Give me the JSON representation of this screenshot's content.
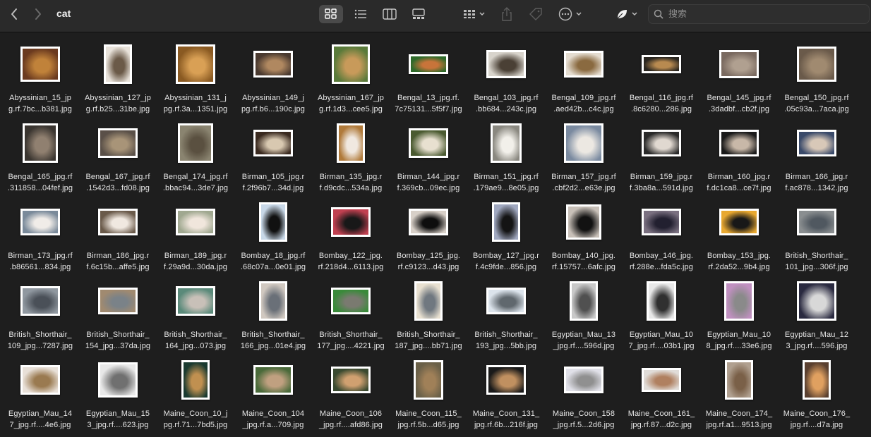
{
  "window": {
    "title": "cat"
  },
  "toolbar": {
    "views": [
      "icon-view",
      "list-view",
      "column-view",
      "gallery-view"
    ],
    "active_view": "icon-view"
  },
  "search": {
    "placeholder": "搜索",
    "value": ""
  },
  "files": [
    {
      "l1": "Abyssinian_15_jp",
      "l2": "g.rf.7bc...b381.jpg"
    },
    {
      "l1": "Abyssinian_127_jp",
      "l2": "g.rf.b25...31be.jpg"
    },
    {
      "l1": "Abyssinian_131_j",
      "l2": "pg.rf.3a...1351.jpg"
    },
    {
      "l1": "Abyssinian_149_j",
      "l2": "pg.rf.b6...190c.jpg"
    },
    {
      "l1": "Abyssinian_167_jp",
      "l2": "g.rf.1d3...cee5.jpg"
    },
    {
      "l1": "Bengal_13_jpg.rf.",
      "l2": "7c75131...5f5f7.jpg"
    },
    {
      "l1": "Bengal_103_jpg.rf",
      "l2": ".bb684...243c.jpg"
    },
    {
      "l1": "Bengal_109_jpg.rf",
      "l2": ".aed42b...c4c.jpg"
    },
    {
      "l1": "Bengal_116_jpg.rf",
      "l2": ".8c6280...286.jpg"
    },
    {
      "l1": "Bengal_145_jpg.rf",
      "l2": ".3dadbf...cb2f.jpg"
    },
    {
      "l1": "Bengal_150_jpg.rf",
      "l2": ".05c93a...7aca.jpg"
    },
    {
      "l1": "Bengal_165_jpg.rf",
      "l2": ".311858...04fef.jpg"
    },
    {
      "l1": "Bengal_167_jpg.rf",
      "l2": ".1542d3...fd08.jpg"
    },
    {
      "l1": "Bengal_174_jpg.rf",
      "l2": ".bbac94...3de7.jpg"
    },
    {
      "l1": "Birman_105_jpg.r",
      "l2": "f.2f96b7...34d.jpg"
    },
    {
      "l1": "Birman_135_jpg.r",
      "l2": "f.d9cdc...534a.jpg"
    },
    {
      "l1": "Birman_144_jpg.r",
      "l2": "f.369cb...09ec.jpg"
    },
    {
      "l1": "Birman_151_jpg.rf",
      "l2": ".179ae9...8e05.jpg"
    },
    {
      "l1": "Birman_157_jpg.rf",
      "l2": ".cbf2d2...e63e.jpg"
    },
    {
      "l1": "Birman_159_jpg.r",
      "l2": "f.3ba8a...591d.jpg"
    },
    {
      "l1": "Birman_160_jpg.r",
      "l2": "f.dc1ca8...ce7f.jpg"
    },
    {
      "l1": "Birman_166_jpg.r",
      "l2": "f.ac878...1342.jpg"
    },
    {
      "l1": "Birman_173_jpg.rf",
      "l2": ".b86561...834.jpg"
    },
    {
      "l1": "Birman_186_jpg.r",
      "l2": "f.6c15b...affe5.jpg"
    },
    {
      "l1": "Birman_189_jpg.r",
      "l2": "f.29a9d...30da.jpg"
    },
    {
      "l1": "Bombay_18_jpg.rf",
      "l2": ".68c07a...0e01.jpg"
    },
    {
      "l1": "Bombay_122_jpg.",
      "l2": "rf.218d4...6113.jpg"
    },
    {
      "l1": "Bombay_125_jpg.",
      "l2": "rf.c9123...d43.jpg"
    },
    {
      "l1": "Bombay_127_jpg.r",
      "l2": "f.4c9fde...856.jpg"
    },
    {
      "l1": "Bombay_140_jpg.",
      "l2": "rf.15757...6afc.jpg"
    },
    {
      "l1": "Bombay_146_jpg.",
      "l2": "rf.288e...fda5c.jpg"
    },
    {
      "l1": "Bombay_153_jpg.",
      "l2": "rf.2da52...9b4.jpg"
    },
    {
      "l1": "British_Shorthair_",
      "l2": "101_jpg...306f.jpg"
    },
    {
      "l1": "British_Shorthair_",
      "l2": "109_jpg...7287.jpg"
    },
    {
      "l1": "British_Shorthair_",
      "l2": "154_jpg...37da.jpg"
    },
    {
      "l1": "British_Shorthair_",
      "l2": "164_jpg...073.jpg"
    },
    {
      "l1": "British_Shorthair_",
      "l2": "166_jpg...01e4.jpg"
    },
    {
      "l1": "British_Shorthair_",
      "l2": "177_jpg....4221.jpg"
    },
    {
      "l1": "British_Shorthair_",
      "l2": "187_jpg....bb71.jpg"
    },
    {
      "l1": "British_Shorthair_",
      "l2": "193_jpg...5bb.jpg"
    },
    {
      "l1": "Egyptian_Mau_13",
      "l2": "_jpg.rf....596d.jpg"
    },
    {
      "l1": "Egyptian_Mau_10",
      "l2": "7_jpg.rf....03b1.jpg"
    },
    {
      "l1": "Egyptian_Mau_10",
      "l2": "8_jpg.rf....33e6.jpg"
    },
    {
      "l1": "Egyptian_Mau_12",
      "l2": "3_jpg.rf....596.jpg"
    },
    {
      "l1": "Egyptian_Mau_14",
      "l2": "7_jpg.rf....4e6.jpg"
    },
    {
      "l1": "Egyptian_Mau_15",
      "l2": "3_jpg.rf....623.jpg"
    },
    {
      "l1": "Maine_Coon_10_j",
      "l2": "pg.rf.71...7bd5.jpg"
    },
    {
      "l1": "Maine_Coon_104",
      "l2": "_jpg.rf.a...709.jpg"
    },
    {
      "l1": "Maine_Coon_106",
      "l2": "_jpg.rf....afd86.jpg"
    },
    {
      "l1": "Maine_Coon_115_",
      "l2": "jpg.rf.5b...d65.jpg"
    },
    {
      "l1": "Maine_Coon_131_",
      "l2": "jpg.rf.6b...216f.jpg"
    },
    {
      "l1": "Maine_Coon_158",
      "l2": "_jpg.rf.5...2d6.jpg"
    },
    {
      "l1": "Maine_Coon_161_",
      "l2": "jpg.rf.87...d2c.jpg"
    },
    {
      "l1": "Maine_Coon_174_",
      "l2": "jpg.rf.a1...9513.jpg"
    },
    {
      "l1": "Maine_Coon_176_",
      "l2": "jpg.rf....d7a.jpg"
    }
  ]
}
